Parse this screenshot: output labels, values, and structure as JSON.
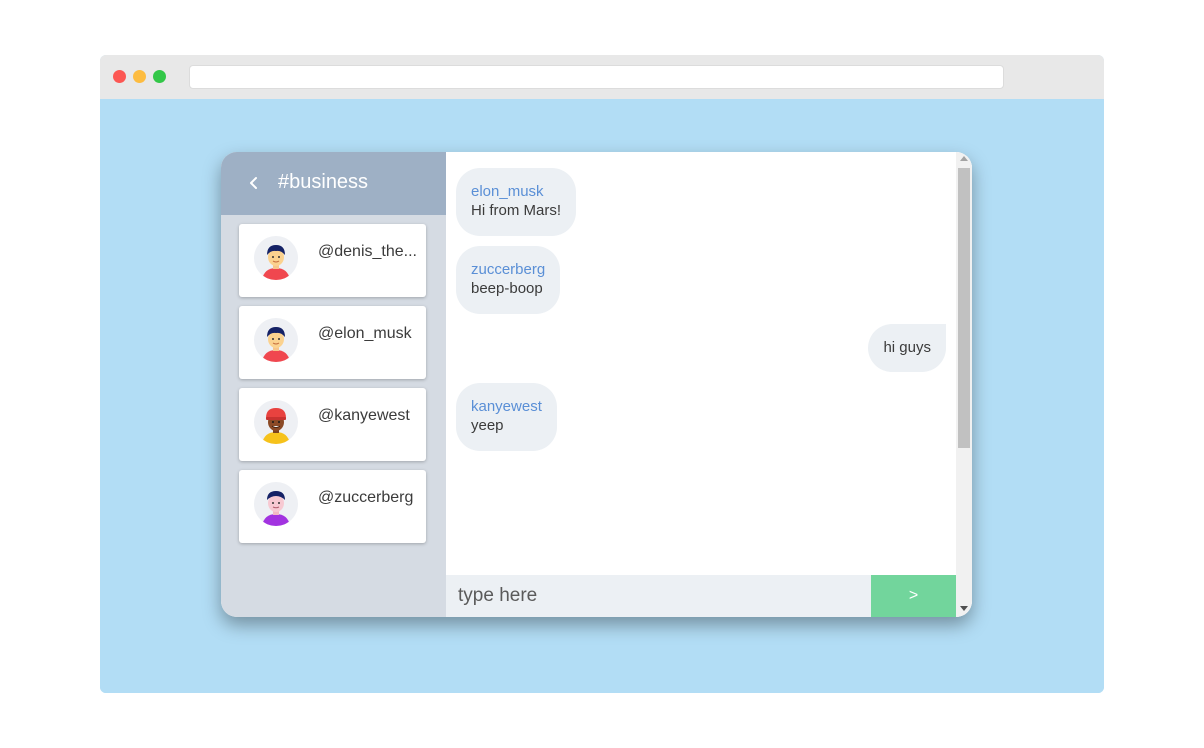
{
  "browser": {
    "address_value": ""
  },
  "chat": {
    "channel_title": "#business",
    "back_icon": "chevron-left-icon",
    "users": [
      {
        "handle": "@denis_the...",
        "avatar": "man-dark-hair-red-shirt"
      },
      {
        "handle": "@elon_musk",
        "avatar": "man-dark-hair-red-shirt"
      },
      {
        "handle": "@kanyewest",
        "avatar": "man-red-cap-yellow-shirt"
      },
      {
        "handle": "@zuccerberg",
        "avatar": "man-dark-hair-purple-shirt"
      }
    ],
    "messages": [
      {
        "sender": "elon_musk",
        "text": "Hi from Mars!",
        "direction": "in"
      },
      {
        "sender": "zuccerberg",
        "text": "beep-boop",
        "direction": "in"
      },
      {
        "sender": "",
        "text": "hi guys",
        "direction": "out"
      },
      {
        "sender": "kanyewest",
        "text": "yeep",
        "direction": "in"
      }
    ],
    "input": {
      "placeholder": "type here",
      "value": ""
    },
    "send_label": ">"
  },
  "colors": {
    "page_background": "#b2ddf5",
    "sidebar_header": "#9eb0c5",
    "sidebar": "#d5dbe3",
    "bubble": "#ecf0f4",
    "sender_name": "#5a8fd6",
    "send_button": "#72d59c"
  }
}
